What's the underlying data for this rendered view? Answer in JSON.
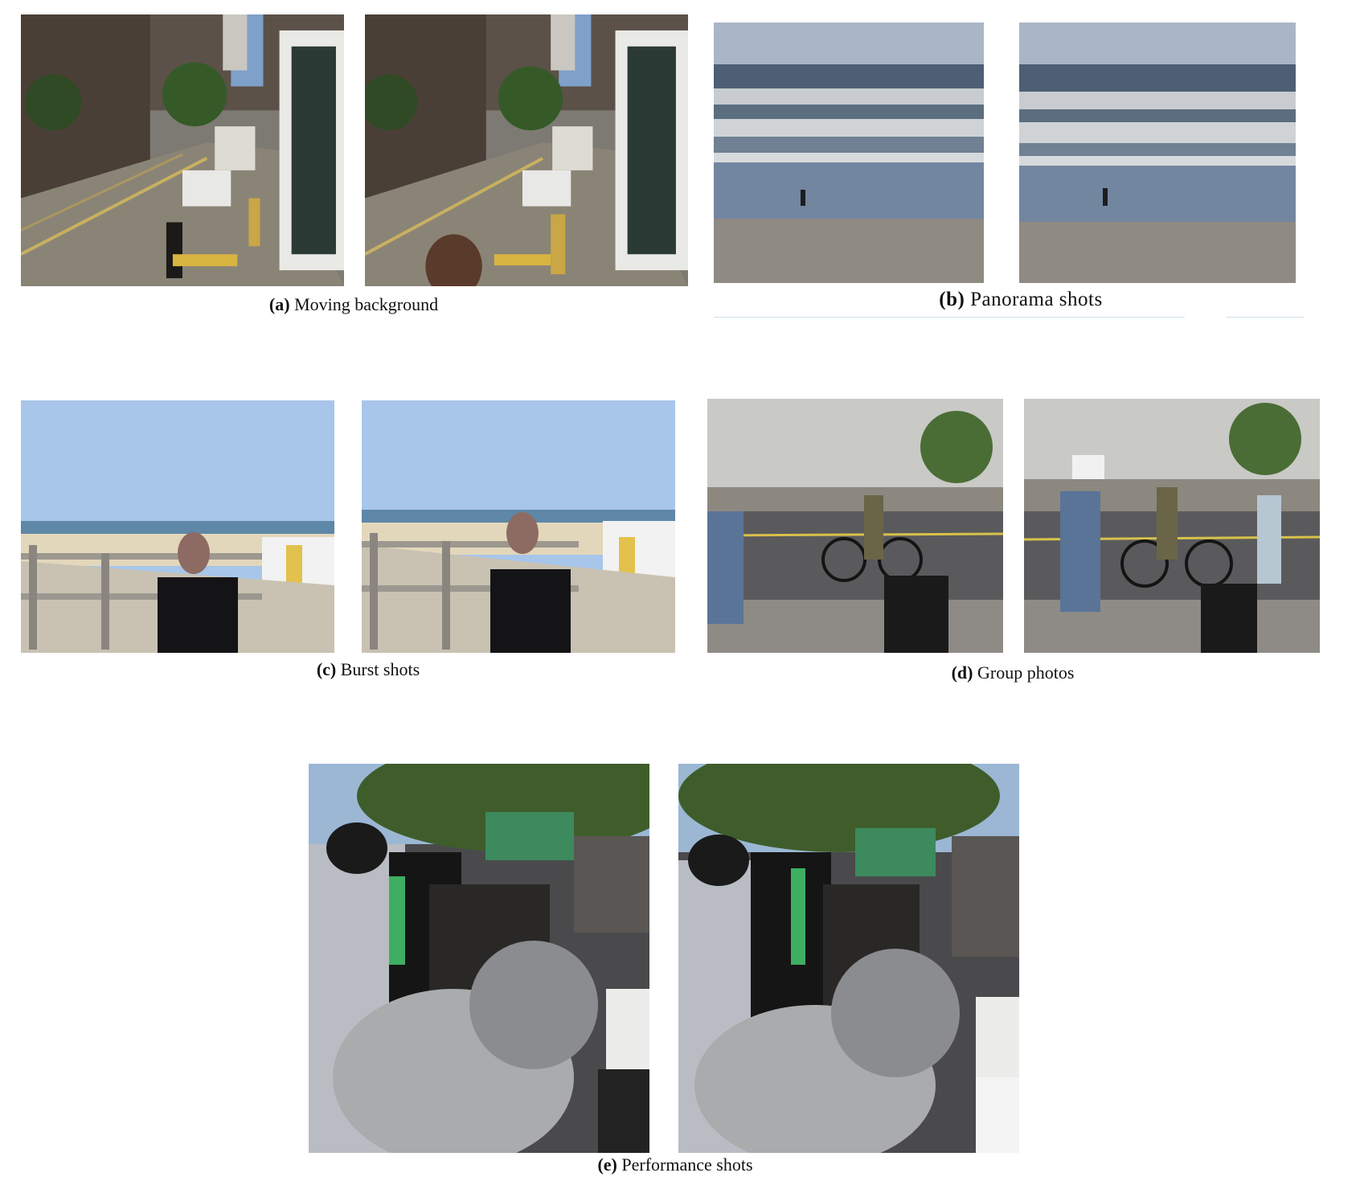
{
  "panels": [
    {
      "label": "(a)",
      "text": "Moving background",
      "left_desc": "street scene frame 1",
      "right_desc": "street scene frame 2"
    },
    {
      "label": "(b)",
      "text": "Panorama shots"
    },
    {
      "label": "(c)",
      "text": "Burst shots"
    },
    {
      "label": "(d)",
      "text": "Group photos"
    },
    {
      "label": "(e)",
      "text": "Performance shots"
    }
  ]
}
